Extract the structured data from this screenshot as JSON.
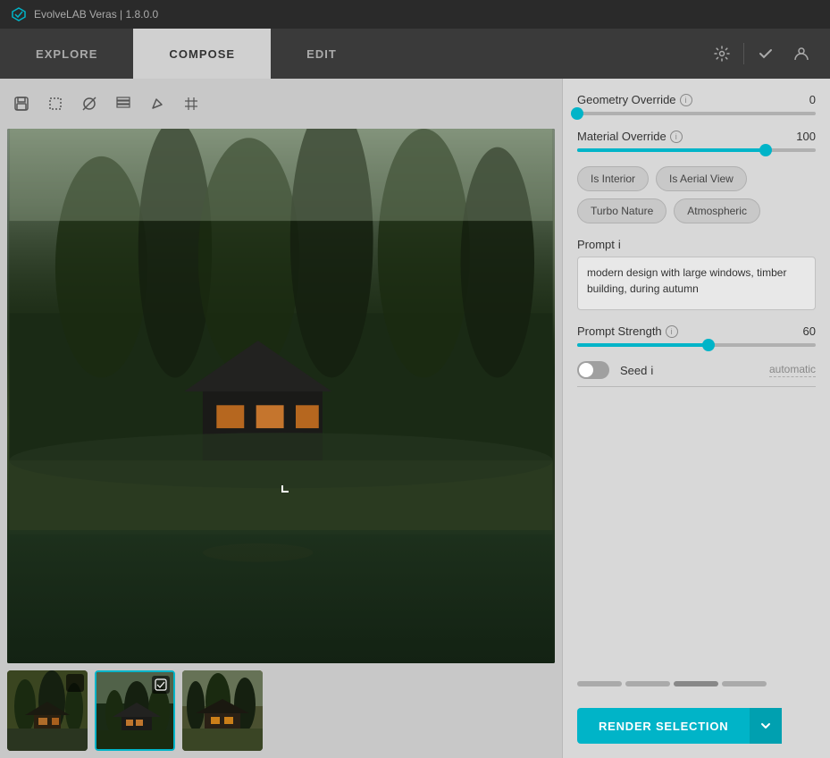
{
  "app": {
    "title": "EvolveLAB Veras | 1.8.0.0"
  },
  "nav": {
    "tabs": [
      {
        "label": "EXPLORE",
        "id": "explore",
        "active": false
      },
      {
        "label": "COMPOSE",
        "id": "compose",
        "active": true
      },
      {
        "label": "EDIT",
        "id": "edit",
        "active": false
      }
    ],
    "settings_icon": "⚙",
    "check_icon": "✓",
    "user_icon": "👤"
  },
  "toolbar": {
    "tools": [
      {
        "id": "save",
        "icon": "⬡",
        "label": "save-icon"
      },
      {
        "id": "crop",
        "icon": "⊡",
        "label": "crop-icon"
      },
      {
        "id": "mask",
        "icon": "◎",
        "label": "mask-icon"
      },
      {
        "id": "layers",
        "icon": "⊞",
        "label": "layers-icon"
      },
      {
        "id": "pen",
        "icon": "✏",
        "label": "pen-icon"
      },
      {
        "id": "grid",
        "icon": "⊞",
        "label": "grid-icon"
      }
    ]
  },
  "right_panel": {
    "geometry_override": {
      "label": "Geometry Override",
      "value": 0,
      "fill_percent": 0
    },
    "material_override": {
      "label": "Material Override",
      "value": 100,
      "fill_percent": 79
    },
    "chips": [
      {
        "label": "Is Interior",
        "id": "is-interior"
      },
      {
        "label": "Is Aerial View",
        "id": "is-aerial-view"
      },
      {
        "label": "Turbo Nature",
        "id": "turbo-nature"
      },
      {
        "label": "Atmospheric",
        "id": "atmospheric"
      }
    ],
    "prompt": {
      "label": "Prompt",
      "value": "modern design with large windows, timber building, during autumn"
    },
    "prompt_strength": {
      "label": "Prompt Strength",
      "value": 60,
      "fill_percent": 55
    },
    "seed": {
      "label": "Seed",
      "toggle_on": false,
      "value": "automatic"
    }
  },
  "bottom_bar": {
    "render_button": "RENDER SELECTION",
    "chevron": "⌄"
  },
  "thumbnails": [
    {
      "id": "thumb1",
      "selected": false
    },
    {
      "id": "thumb2",
      "selected": true
    },
    {
      "id": "thumb3",
      "selected": false
    }
  ]
}
